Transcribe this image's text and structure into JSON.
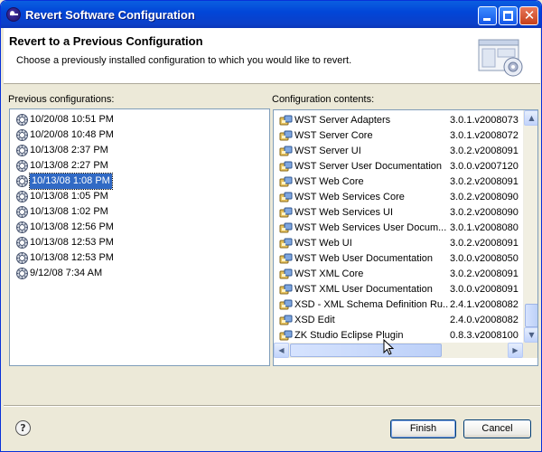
{
  "window": {
    "title": "Revert Software Configuration"
  },
  "header": {
    "title": "Revert to a Previous Configuration",
    "description": "Choose a previously installed configuration to which you would like to revert."
  },
  "previous": {
    "label": "Previous configurations:",
    "items": [
      "10/20/08 10:51 PM",
      "10/20/08 10:48 PM",
      "10/13/08 2:37 PM",
      "10/13/08 2:27 PM",
      "10/13/08 1:08 PM",
      "10/13/08 1:05 PM",
      "10/13/08 1:02 PM",
      "10/13/08 12:56 PM",
      "10/13/08 12:53 PM",
      "10/13/08 12:53 PM",
      "9/12/08 7:34 AM"
    ],
    "selected_index": 4
  },
  "contents": {
    "label": "Configuration contents:",
    "items": [
      {
        "name": "WST Server Adapters",
        "version": "3.0.1.v2008073"
      },
      {
        "name": "WST Server Core",
        "version": "3.0.1.v2008072"
      },
      {
        "name": "WST Server UI",
        "version": "3.0.2.v2008091"
      },
      {
        "name": "WST Server User Documentation",
        "version": "3.0.0.v2007120"
      },
      {
        "name": "WST Web Core",
        "version": "3.0.2.v2008091"
      },
      {
        "name": "WST Web Services Core",
        "version": "3.0.2.v2008090"
      },
      {
        "name": "WST Web Services UI",
        "version": "3.0.2.v2008090"
      },
      {
        "name": "WST Web Services User Docum...",
        "version": "3.0.1.v2008080"
      },
      {
        "name": "WST Web UI",
        "version": "3.0.2.v2008091"
      },
      {
        "name": "WST Web User Documentation",
        "version": "3.0.0.v2008050"
      },
      {
        "name": "WST XML Core",
        "version": "3.0.2.v2008091"
      },
      {
        "name": "WST XML User Documentation",
        "version": "3.0.0.v2008091"
      },
      {
        "name": "XSD - XML Schema Definition Ru...",
        "version": "2.4.1.v2008082"
      },
      {
        "name": "XSD Edit",
        "version": "2.4.0.v2008082"
      },
      {
        "name": "ZK Studio Eclipse Plugin",
        "version": "0.8.3.v2008100"
      }
    ]
  },
  "buttons": {
    "help": "?",
    "finish": "Finish",
    "cancel": "Cancel"
  },
  "colors": {
    "titlebar": "#0246d8",
    "selection": "#316ac5",
    "dialog_bg": "#ece9d8"
  },
  "icons": {
    "app": "eclipse-icon",
    "config": "configuration-gear-icon",
    "feature": "feature-plug-icon",
    "help": "help-icon"
  }
}
